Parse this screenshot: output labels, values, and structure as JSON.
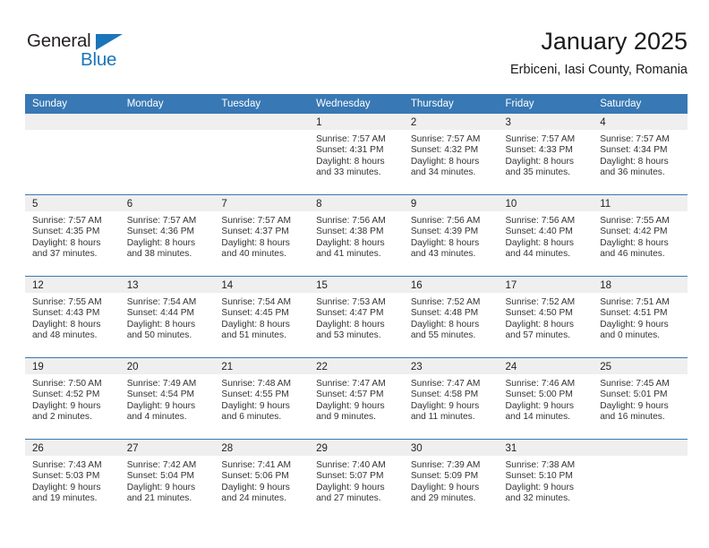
{
  "brand": {
    "name_part1": "General",
    "name_part2": "Blue",
    "accent_color": "#1b75bb"
  },
  "header": {
    "title": "January 2025",
    "subtitle": "Erbiceni, Iasi County, Romania"
  },
  "theme": {
    "header_row_bg": "#3878b4",
    "daynum_bg": "#efefef",
    "text_color": "#333333"
  },
  "weekday_headers": [
    "Sunday",
    "Monday",
    "Tuesday",
    "Wednesday",
    "Thursday",
    "Friday",
    "Saturday"
  ],
  "weeks": [
    [
      {
        "day": "",
        "empty": true,
        "sunrise": "",
        "sunset": "",
        "daylight1": "",
        "daylight2": ""
      },
      {
        "day": "",
        "empty": true,
        "sunrise": "",
        "sunset": "",
        "daylight1": "",
        "daylight2": ""
      },
      {
        "day": "",
        "empty": true,
        "sunrise": "",
        "sunset": "",
        "daylight1": "",
        "daylight2": ""
      },
      {
        "day": "1",
        "empty": false,
        "sunrise": "Sunrise: 7:57 AM",
        "sunset": "Sunset: 4:31 PM",
        "daylight1": "Daylight: 8 hours",
        "daylight2": "and 33 minutes."
      },
      {
        "day": "2",
        "empty": false,
        "sunrise": "Sunrise: 7:57 AM",
        "sunset": "Sunset: 4:32 PM",
        "daylight1": "Daylight: 8 hours",
        "daylight2": "and 34 minutes."
      },
      {
        "day": "3",
        "empty": false,
        "sunrise": "Sunrise: 7:57 AM",
        "sunset": "Sunset: 4:33 PM",
        "daylight1": "Daylight: 8 hours",
        "daylight2": "and 35 minutes."
      },
      {
        "day": "4",
        "empty": false,
        "sunrise": "Sunrise: 7:57 AM",
        "sunset": "Sunset: 4:34 PM",
        "daylight1": "Daylight: 8 hours",
        "daylight2": "and 36 minutes."
      }
    ],
    [
      {
        "day": "5",
        "empty": false,
        "sunrise": "Sunrise: 7:57 AM",
        "sunset": "Sunset: 4:35 PM",
        "daylight1": "Daylight: 8 hours",
        "daylight2": "and 37 minutes."
      },
      {
        "day": "6",
        "empty": false,
        "sunrise": "Sunrise: 7:57 AM",
        "sunset": "Sunset: 4:36 PM",
        "daylight1": "Daylight: 8 hours",
        "daylight2": "and 38 minutes."
      },
      {
        "day": "7",
        "empty": false,
        "sunrise": "Sunrise: 7:57 AM",
        "sunset": "Sunset: 4:37 PM",
        "daylight1": "Daylight: 8 hours",
        "daylight2": "and 40 minutes."
      },
      {
        "day": "8",
        "empty": false,
        "sunrise": "Sunrise: 7:56 AM",
        "sunset": "Sunset: 4:38 PM",
        "daylight1": "Daylight: 8 hours",
        "daylight2": "and 41 minutes."
      },
      {
        "day": "9",
        "empty": false,
        "sunrise": "Sunrise: 7:56 AM",
        "sunset": "Sunset: 4:39 PM",
        "daylight1": "Daylight: 8 hours",
        "daylight2": "and 43 minutes."
      },
      {
        "day": "10",
        "empty": false,
        "sunrise": "Sunrise: 7:56 AM",
        "sunset": "Sunset: 4:40 PM",
        "daylight1": "Daylight: 8 hours",
        "daylight2": "and 44 minutes."
      },
      {
        "day": "11",
        "empty": false,
        "sunrise": "Sunrise: 7:55 AM",
        "sunset": "Sunset: 4:42 PM",
        "daylight1": "Daylight: 8 hours",
        "daylight2": "and 46 minutes."
      }
    ],
    [
      {
        "day": "12",
        "empty": false,
        "sunrise": "Sunrise: 7:55 AM",
        "sunset": "Sunset: 4:43 PM",
        "daylight1": "Daylight: 8 hours",
        "daylight2": "and 48 minutes."
      },
      {
        "day": "13",
        "empty": false,
        "sunrise": "Sunrise: 7:54 AM",
        "sunset": "Sunset: 4:44 PM",
        "daylight1": "Daylight: 8 hours",
        "daylight2": "and 50 minutes."
      },
      {
        "day": "14",
        "empty": false,
        "sunrise": "Sunrise: 7:54 AM",
        "sunset": "Sunset: 4:45 PM",
        "daylight1": "Daylight: 8 hours",
        "daylight2": "and 51 minutes."
      },
      {
        "day": "15",
        "empty": false,
        "sunrise": "Sunrise: 7:53 AM",
        "sunset": "Sunset: 4:47 PM",
        "daylight1": "Daylight: 8 hours",
        "daylight2": "and 53 minutes."
      },
      {
        "day": "16",
        "empty": false,
        "sunrise": "Sunrise: 7:52 AM",
        "sunset": "Sunset: 4:48 PM",
        "daylight1": "Daylight: 8 hours",
        "daylight2": "and 55 minutes."
      },
      {
        "day": "17",
        "empty": false,
        "sunrise": "Sunrise: 7:52 AM",
        "sunset": "Sunset: 4:50 PM",
        "daylight1": "Daylight: 8 hours",
        "daylight2": "and 57 minutes."
      },
      {
        "day": "18",
        "empty": false,
        "sunrise": "Sunrise: 7:51 AM",
        "sunset": "Sunset: 4:51 PM",
        "daylight1": "Daylight: 9 hours",
        "daylight2": "and 0 minutes."
      }
    ],
    [
      {
        "day": "19",
        "empty": false,
        "sunrise": "Sunrise: 7:50 AM",
        "sunset": "Sunset: 4:52 PM",
        "daylight1": "Daylight: 9 hours",
        "daylight2": "and 2 minutes."
      },
      {
        "day": "20",
        "empty": false,
        "sunrise": "Sunrise: 7:49 AM",
        "sunset": "Sunset: 4:54 PM",
        "daylight1": "Daylight: 9 hours",
        "daylight2": "and 4 minutes."
      },
      {
        "day": "21",
        "empty": false,
        "sunrise": "Sunrise: 7:48 AM",
        "sunset": "Sunset: 4:55 PM",
        "daylight1": "Daylight: 9 hours",
        "daylight2": "and 6 minutes."
      },
      {
        "day": "22",
        "empty": false,
        "sunrise": "Sunrise: 7:47 AM",
        "sunset": "Sunset: 4:57 PM",
        "daylight1": "Daylight: 9 hours",
        "daylight2": "and 9 minutes."
      },
      {
        "day": "23",
        "empty": false,
        "sunrise": "Sunrise: 7:47 AM",
        "sunset": "Sunset: 4:58 PM",
        "daylight1": "Daylight: 9 hours",
        "daylight2": "and 11 minutes."
      },
      {
        "day": "24",
        "empty": false,
        "sunrise": "Sunrise: 7:46 AM",
        "sunset": "Sunset: 5:00 PM",
        "daylight1": "Daylight: 9 hours",
        "daylight2": "and 14 minutes."
      },
      {
        "day": "25",
        "empty": false,
        "sunrise": "Sunrise: 7:45 AM",
        "sunset": "Sunset: 5:01 PM",
        "daylight1": "Daylight: 9 hours",
        "daylight2": "and 16 minutes."
      }
    ],
    [
      {
        "day": "26",
        "empty": false,
        "sunrise": "Sunrise: 7:43 AM",
        "sunset": "Sunset: 5:03 PM",
        "daylight1": "Daylight: 9 hours",
        "daylight2": "and 19 minutes."
      },
      {
        "day": "27",
        "empty": false,
        "sunrise": "Sunrise: 7:42 AM",
        "sunset": "Sunset: 5:04 PM",
        "daylight1": "Daylight: 9 hours",
        "daylight2": "and 21 minutes."
      },
      {
        "day": "28",
        "empty": false,
        "sunrise": "Sunrise: 7:41 AM",
        "sunset": "Sunset: 5:06 PM",
        "daylight1": "Daylight: 9 hours",
        "daylight2": "and 24 minutes."
      },
      {
        "day": "29",
        "empty": false,
        "sunrise": "Sunrise: 7:40 AM",
        "sunset": "Sunset: 5:07 PM",
        "daylight1": "Daylight: 9 hours",
        "daylight2": "and 27 minutes."
      },
      {
        "day": "30",
        "empty": false,
        "sunrise": "Sunrise: 7:39 AM",
        "sunset": "Sunset: 5:09 PM",
        "daylight1": "Daylight: 9 hours",
        "daylight2": "and 29 minutes."
      },
      {
        "day": "31",
        "empty": false,
        "sunrise": "Sunrise: 7:38 AM",
        "sunset": "Sunset: 5:10 PM",
        "daylight1": "Daylight: 9 hours",
        "daylight2": "and 32 minutes."
      },
      {
        "day": "",
        "empty": true,
        "sunrise": "",
        "sunset": "",
        "daylight1": "",
        "daylight2": ""
      }
    ]
  ]
}
